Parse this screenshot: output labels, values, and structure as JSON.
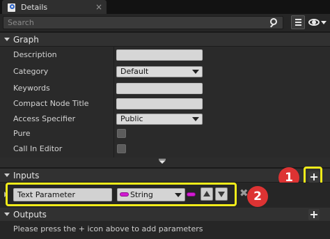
{
  "tab": {
    "title": "Details",
    "icon": "details-magnifier-icon",
    "close": "×"
  },
  "search": {
    "placeholder": "Search",
    "icon": "search-icon"
  },
  "toolbar": {
    "view_options_icon": "grid-list-icon",
    "visibility_icon": "eye-icon"
  },
  "graph": {
    "title": "Graph",
    "rows": [
      {
        "label": "Description",
        "type": "text",
        "value": ""
      },
      {
        "label": "Category",
        "type": "combo",
        "value": "Default"
      },
      {
        "label": "Keywords",
        "type": "text",
        "value": ""
      },
      {
        "label": "Compact Node Title",
        "type": "text",
        "value": ""
      },
      {
        "label": "Access Specifier",
        "type": "combo",
        "value": "Public"
      },
      {
        "label": "Pure",
        "type": "checkbox",
        "value": false
      },
      {
        "label": "Call In Editor",
        "type": "checkbox",
        "value": false
      }
    ]
  },
  "inputs": {
    "title": "Inputs",
    "params": [
      {
        "name": "Text Parameter",
        "type": "String"
      }
    ]
  },
  "outputs": {
    "title": "Outputs",
    "hint": "Please press the + icon above to add parameters"
  },
  "annotations": {
    "badge1": "1",
    "badge2": "2",
    "highlight_color": "#f2ec1a",
    "badge_color": "#dd3333"
  },
  "colors": {
    "string_pin": "#d21bd2",
    "panel_bg": "#2a2a2a",
    "header_bg": "#313131"
  }
}
